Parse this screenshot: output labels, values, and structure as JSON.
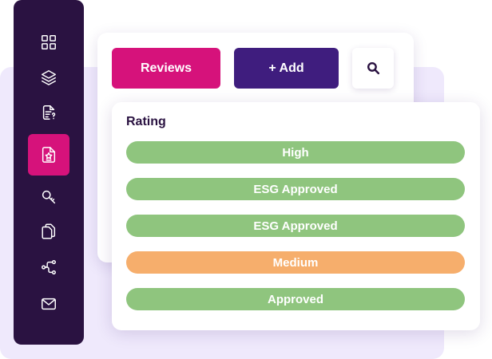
{
  "toolbar": {
    "reviews_label": "Reviews",
    "add_label": "+ Add"
  },
  "sidebar": {
    "items": [
      {
        "icon": "dashboard-grid-icon",
        "active": false
      },
      {
        "icon": "layers-icon",
        "active": false
      },
      {
        "icon": "document-icon",
        "active": false
      },
      {
        "icon": "rated-document-icon",
        "active": true
      },
      {
        "icon": "key-icon",
        "active": false
      },
      {
        "icon": "copy-files-icon",
        "active": false
      },
      {
        "icon": "workflow-icon",
        "active": false
      },
      {
        "icon": "mail-icon",
        "active": false
      }
    ]
  },
  "rating": {
    "title": "Rating",
    "items": [
      {
        "label": "High",
        "color": "#8fc57e"
      },
      {
        "label": "ESG Approved",
        "color": "#8fc57e"
      },
      {
        "label": "ESG Approved",
        "color": "#8fc57e"
      },
      {
        "label": "Medium",
        "color": "#f6ae6c"
      },
      {
        "label": "Approved",
        "color": "#8fc57e"
      }
    ]
  },
  "colors": {
    "sidebar": "#2a1241",
    "accent_pink": "#d6127b",
    "accent_purple": "#3f1d7e",
    "background_tint": "#efe9fc",
    "rating_green": "#8fc57e",
    "rating_orange": "#f6ae6c"
  }
}
